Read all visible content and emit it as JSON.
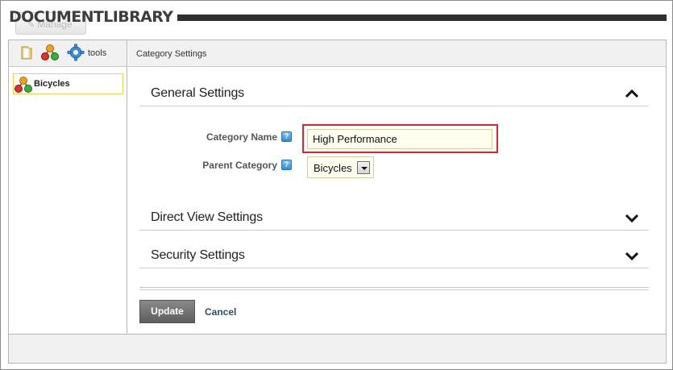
{
  "header": {
    "manage_label": "Manage",
    "module_title": "DOCUMENTLIBRARY"
  },
  "left_toolbar": {
    "icons": [
      "folder-icon",
      "category-icon",
      "gear-icon"
    ],
    "tools_label": "tools"
  },
  "tree": {
    "items": [
      {
        "label": "Bicycles",
        "icon": "category-icon",
        "selected": true
      }
    ]
  },
  "right_pane": {
    "header_label": "Category Settings"
  },
  "sections": {
    "general": {
      "title": "General Settings",
      "expanded": true,
      "chevron": "chevron-up-icon"
    },
    "direct_view": {
      "title": "Direct View Settings",
      "expanded": false,
      "chevron": "chevron-down-icon"
    },
    "security": {
      "title": "Security Settings",
      "expanded": false,
      "chevron": "chevron-down-icon"
    }
  },
  "form": {
    "category_name": {
      "label": "Category Name",
      "value": "High Performance",
      "help_icon": "help-icon"
    },
    "parent_category": {
      "label": "Parent Category",
      "selected": "Bicycles",
      "help_icon": "help-icon"
    }
  },
  "actions": {
    "update_label": "Update",
    "cancel_label": "Cancel"
  },
  "colors": {
    "highlight": "#e0242c",
    "title_bar": "#2f2f2f",
    "selected_border": "#e6d34a",
    "link": "#2a4f77"
  }
}
